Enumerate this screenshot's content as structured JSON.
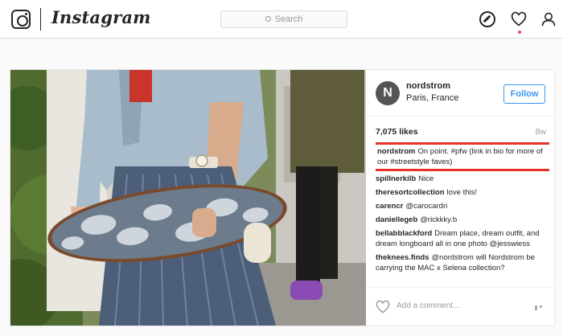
{
  "app": {
    "wordmark": "Instagram"
  },
  "nav": {
    "search_placeholder": "Search",
    "icons": [
      "explore-compass-icon",
      "activity-heart-icon",
      "profile-user-icon"
    ],
    "notification_color": "#ed4956"
  },
  "post": {
    "author": {
      "avatar_letter": "N",
      "username": "nordstrom",
      "location": "Paris, France",
      "follow_label": "Follow"
    },
    "likes": "7,075 likes",
    "time_ago": "8w",
    "caption": {
      "username": "nordstrom",
      "text": "On point. #pfw (link in bio for more of our #streetstyle faves)",
      "highlight_color": "#e53228"
    },
    "comments": [
      {
        "username": "spillnerkilb",
        "text": "Nice"
      },
      {
        "username": "theresortcollection",
        "text": "love this!"
      },
      {
        "username": "carencr",
        "text": "@carocardri"
      },
      {
        "username": "daniellegeb",
        "text": "@rickkky.b"
      },
      {
        "username": "bellabblackford",
        "text": "Dream place, dream outfit, and dream longboard all in one photo @jesswiess"
      },
      {
        "username": "theknees.finds",
        "text": "@nordstrom will Nordstrom be carrying the MAC x Selena collection?"
      }
    ],
    "add_comment_placeholder": "Add a comment...",
    "accent_color": "#3897f0"
  }
}
